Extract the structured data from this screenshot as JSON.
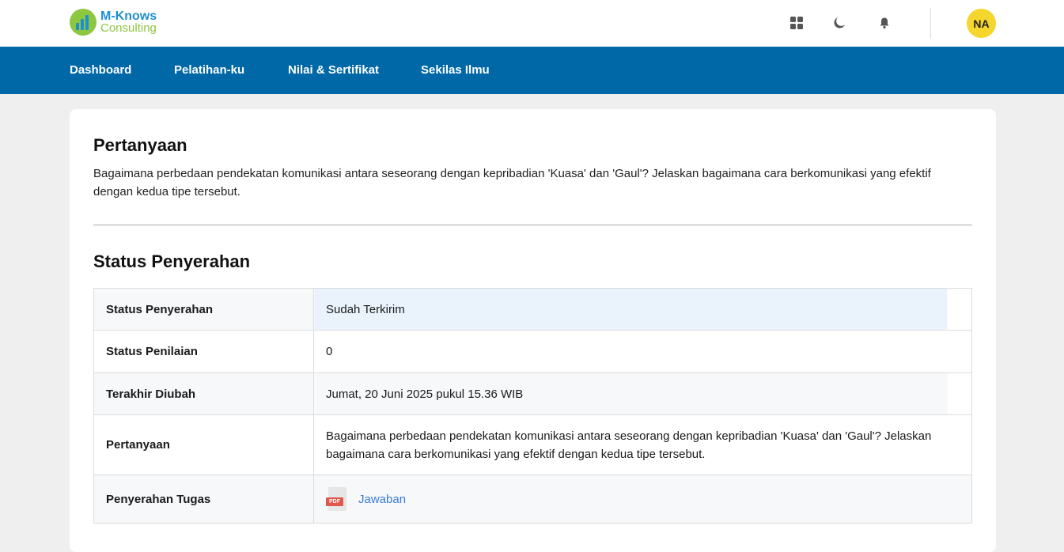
{
  "brand": {
    "name_line1": "M-Knows",
    "name_line2": "Consulting"
  },
  "header": {
    "icons": [
      "apps-grid-icon",
      "moon-icon",
      "bell-icon"
    ],
    "avatar_initials": "NA"
  },
  "nav": {
    "items": [
      {
        "label": "Dashboard"
      },
      {
        "label": "Pelatihan-ku"
      },
      {
        "label": "Nilai & Sertifikat"
      },
      {
        "label": "Sekilas Ilmu"
      }
    ]
  },
  "question": {
    "title": "Pertanyaan",
    "text": "Bagaimana perbedaan pendekatan komunikasi antara seseorang dengan kepribadian 'Kuasa' dan 'Gaul'? Jelaskan bagaimana cara berkomunikasi yang efektif dengan kedua tipe tersebut."
  },
  "submission": {
    "title": "Status Penyerahan",
    "rows": [
      {
        "label": "Status Penyerahan",
        "value": "Sudah Terkirim"
      },
      {
        "label": "Status Penilaian",
        "value": "0"
      },
      {
        "label": "Terakhir Diubah",
        "value": "Jumat, 20 Juni 2025 pukul 15.36 WIB"
      },
      {
        "label": "Pertanyaan",
        "value": "Bagaimana perbedaan pendekatan komunikasi antara seseorang dengan kepribadian 'Kuasa' dan 'Gaul'? Jelaskan bagaimana cara berkomunikasi yang efektif dengan kedua tipe tersebut."
      },
      {
        "label": "Penyerahan Tugas",
        "file_badge": "PDF",
        "link_text": "Jawaban"
      }
    ]
  },
  "colors": {
    "nav_bg": "#0068a6",
    "avatar_bg": "#f5d62e",
    "link": "#3a7bd5",
    "brand_green": "#8dc63f",
    "brand_blue": "#1f8fd0"
  }
}
